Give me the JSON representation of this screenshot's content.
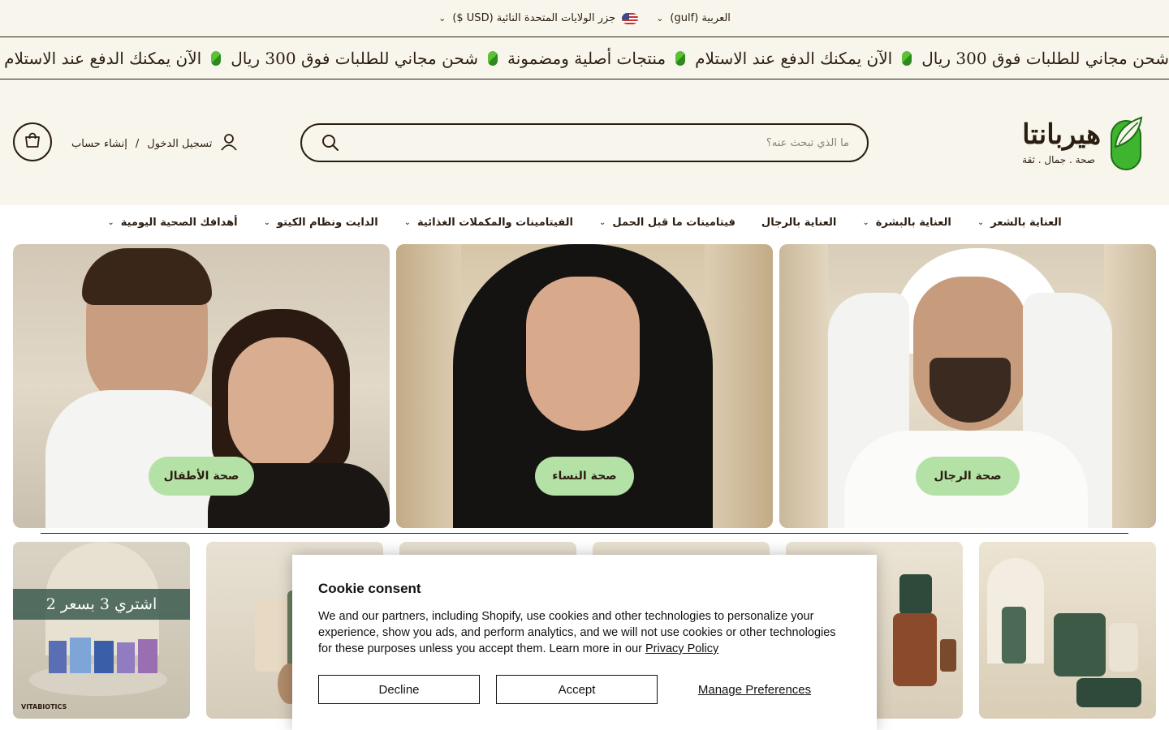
{
  "topbar": {
    "language_label": "العربية (gulf)",
    "country_label": "جزر الولايات المتحدة النائية (USD $)"
  },
  "marquee": {
    "items": [
      "شحن مجاني للطلبات فوق 300 ريال",
      "الآن يمكنك الدفع عند الاستلام",
      "منتجات أصلية ومضمونة",
      "شحن مجاني للطلبات فوق 300 ريال",
      "الآن يمكنك الدفع عند الاستلام",
      "منتجات أصلية ومضمونة",
      "شحن مجاني للطلبات فوق 300 ريال"
    ]
  },
  "header": {
    "logo_name": "هيربانتا",
    "logo_tagline": "صحة . جمال . ثقة",
    "search_placeholder": "ما الذي تبحث عنه؟",
    "login_label": "تسجيل الدخول",
    "separator": "/",
    "register_label": "إنشاء حساب"
  },
  "nav": {
    "items": [
      {
        "label": "العناية بالشعر",
        "has_dropdown": true
      },
      {
        "label": "العناية بالبشرة",
        "has_dropdown": true
      },
      {
        "label": "العناية بالرجال",
        "has_dropdown": false
      },
      {
        "label": "فيتامينات ما قبل الحمل",
        "has_dropdown": true
      },
      {
        "label": "الفيتامينات والمكملات الغذائية",
        "has_dropdown": true
      },
      {
        "label": "الدايت ونظام الكيتو",
        "has_dropdown": true
      },
      {
        "label": "أهدافك الصحية اليومية",
        "has_dropdown": true
      }
    ]
  },
  "hero": {
    "men_label": "صحة الرجال",
    "women_label": "صحة النساء",
    "kids_label": "صحة الأطفال"
  },
  "products": {
    "promo_text": "اشتري 3 بسعر 2",
    "promo_brand": "VITABIOTICS"
  },
  "cookie": {
    "title": "Cookie consent",
    "body": "We and our partners, including Shopify, use cookies and other technologies to personalize your experience, show you ads, and perform analytics, and we will not use cookies or other technologies for these purposes unless you accept them. Learn more in our ",
    "privacy_link": "Privacy Policy",
    "decline_label": "Decline",
    "accept_label": "Accept",
    "manage_label": "Manage Preferences"
  },
  "colors": {
    "cream": "#f8f6ec",
    "dark_brown": "#2b1d10",
    "pill_green": "#b4e2a6",
    "brand_green": "#2e9a2a"
  }
}
